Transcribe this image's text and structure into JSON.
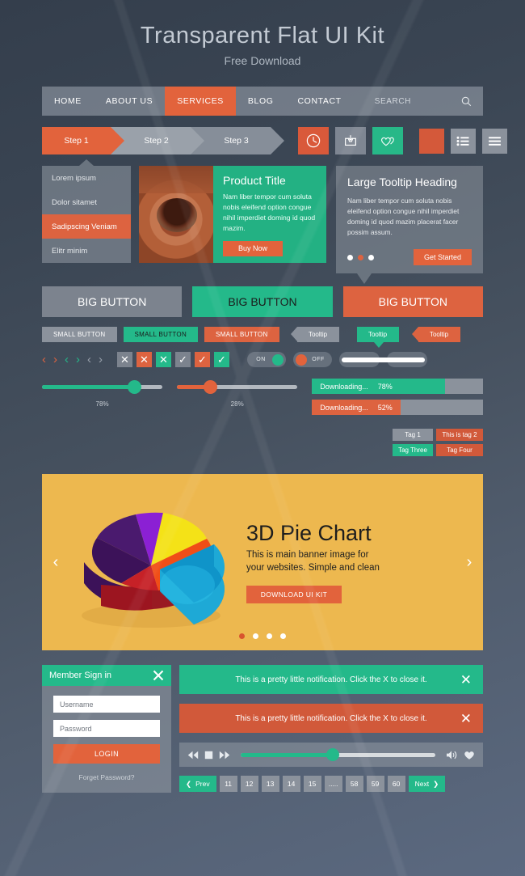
{
  "header": {
    "title": "Transparent Flat UI Kit",
    "subtitle": "Free Download"
  },
  "nav": {
    "items": [
      {
        "label": "HOME",
        "active": false
      },
      {
        "label": "ABOUT US",
        "active": false
      },
      {
        "label": "SERVICES",
        "active": true
      },
      {
        "label": "BLOG",
        "active": false
      },
      {
        "label": "CONTACT",
        "active": false
      }
    ],
    "search_placeholder": "SEARCH",
    "search_icon": "search-icon"
  },
  "steps": [
    {
      "label": "Step 1"
    },
    {
      "label": "Step 2"
    },
    {
      "label": "Step 3"
    }
  ],
  "icon_buttons": [
    {
      "icon": "clock-icon",
      "color": "#d9593a"
    },
    {
      "icon": "inbox-download-icon",
      "color": "#7e8692"
    },
    {
      "icon": "hearts-icon",
      "color": "#27b888"
    }
  ],
  "square_buttons": [
    {
      "icon": "blank-orange",
      "color": "#d4593a"
    },
    {
      "icon": "list-view-icon",
      "color": "#8b929c"
    },
    {
      "icon": "menu-lines-icon",
      "color": "#8b929c"
    }
  ],
  "side_menu": {
    "items": [
      {
        "label": "Lorem ipsum",
        "selected": false
      },
      {
        "label": "Dolor sitamet",
        "selected": false
      },
      {
        "label": "Sadipscing Veniam",
        "selected": true
      },
      {
        "label": "Elitr minim",
        "selected": false
      }
    ]
  },
  "product_card": {
    "title": "Product Title",
    "body": "Nam liber tempor cum soluta nobis eleifend option congue nihil imperdiet doming id quod mazim.",
    "button": "Buy Now",
    "image_alt": "clay-pottery-photo"
  },
  "tooltip_card": {
    "heading": "Large Tooltip Heading",
    "body": "Nam liber tempor cum soluta nobis eleifend option congue nihil imperdiet doming id quod mazim placerat facer possim assum.",
    "button": "Get Started",
    "dots": [
      {
        "active": false
      },
      {
        "active": true
      },
      {
        "active": false
      }
    ]
  },
  "big_buttons": [
    {
      "label": "BIG BUTTON",
      "color": "#7c838e"
    },
    {
      "label": "BIG BUTTON",
      "color": "#24b98a"
    },
    {
      "label": "BIG BUTTON",
      "color": "#dd6340"
    }
  ],
  "small_buttons": [
    {
      "label": "SMALL BUTTON",
      "color": "#8b929c"
    },
    {
      "label": "SMALL BUTTON",
      "color": "#24b98a"
    },
    {
      "label": "SMALL BUTTON",
      "color": "#dd6340"
    }
  ],
  "tooltips": [
    {
      "label": "Tooltip",
      "color": "#8b929c",
      "arrow": "left"
    },
    {
      "label": "Tooltip",
      "color": "#24b98a",
      "arrow": "bottom"
    },
    {
      "label": "Tooltip",
      "color": "#dd6340",
      "arrow": "left"
    }
  ],
  "arrows": [
    {
      "icon": "chevron-left-icon",
      "color": "#dd6340"
    },
    {
      "icon": "chevron-right-icon",
      "color": "#dd6340"
    },
    {
      "icon": "chevron-left-icon",
      "color": "#24b98a"
    },
    {
      "icon": "chevron-right-icon",
      "color": "#24b98a"
    },
    {
      "icon": "chevron-left-icon",
      "color": "#98a0ab"
    },
    {
      "icon": "chevron-right-icon",
      "color": "#98a0ab"
    }
  ],
  "boxes": [
    {
      "icon": "close-icon",
      "glyph": "✕",
      "color": "#7c838e"
    },
    {
      "icon": "close-icon",
      "glyph": "✕",
      "color": "#dd6340"
    },
    {
      "icon": "close-icon",
      "glyph": "✕",
      "color": "#24b98a"
    },
    {
      "icon": "check-icon",
      "glyph": "✓",
      "color": "#7c838e"
    },
    {
      "icon": "check-icon",
      "glyph": "✓",
      "color": "#dd6340"
    },
    {
      "icon": "check-icon",
      "glyph": "✓",
      "color": "#24b98a"
    }
  ],
  "toggles": [
    {
      "label": "ON",
      "knob": "right",
      "knob_color": "#24b98a"
    },
    {
      "label": "OFF",
      "knob": "left",
      "knob_color": "#e2633c"
    },
    {
      "label": "",
      "knob": "right",
      "knob_color": "#24b98a"
    },
    {
      "label": "",
      "knob": "left",
      "knob_color": "#e2633c"
    }
  ],
  "sliders": [
    {
      "value": 78,
      "value_label": "78%",
      "color": "#24b98a"
    },
    {
      "value": 28,
      "value_label": "28%",
      "color": "#e2633c"
    }
  ],
  "progress_bars": [
    {
      "label": "Downloading...",
      "value_label": "78%",
      "value": 78,
      "color": "#24b98a"
    },
    {
      "label": "Downloading...",
      "value_label": "52%",
      "value": 52,
      "color": "#dd6340"
    }
  ],
  "tags": [
    {
      "label": "Tag 1",
      "color": "#8b929c"
    },
    {
      "label": "This is tag 2",
      "color": "#d1593a"
    },
    {
      "label": "Tag Three",
      "color": "#24b98a"
    },
    {
      "label": "Tag Four",
      "color": "#d1593a"
    }
  ],
  "banner": {
    "title": "3D Pie Chart",
    "body": "This is main banner image for your websites. Simple and clean",
    "button": "DOWNLOAD UI KIT",
    "prev_icon": "chevron-left-icon",
    "next_icon": "chevron-right-icon",
    "background": "#edb84f",
    "dots": [
      {
        "active": true
      },
      {
        "active": false
      },
      {
        "active": false
      },
      {
        "active": false
      }
    ]
  },
  "chart_data": {
    "type": "pie",
    "title": "3D Pie Chart",
    "labels": [
      "Yellow",
      "Cyan",
      "Red",
      "Purple",
      "Violet",
      "Orange"
    ],
    "values": [
      17,
      22,
      18,
      15,
      16,
      12
    ],
    "colors": [
      "#f4e217",
      "#1ebdee",
      "#c62127",
      "#4a1a6e",
      "#8b20d4",
      "#f04e17"
    ],
    "legend": "none",
    "grid": false
  },
  "sign_in": {
    "heading": "Member Sign in",
    "close_icon": "close-icon",
    "username_placeholder": "Username",
    "password_placeholder": "Password",
    "login_label": "LOGIN",
    "forget_label": "Forget Password?"
  },
  "notifications": [
    {
      "text": "This is a pretty little notification. Click the X to close it.",
      "color": "#24b98a",
      "close_icon": "close-icon"
    },
    {
      "text": "This is a pretty little notification. Click the X to close it.",
      "color": "#d1593a",
      "close_icon": "close-icon"
    }
  ],
  "player": {
    "rewind_icon": "rewind-icon",
    "stop_icon": "stop-icon",
    "forward_icon": "fast-forward-icon",
    "volume_icon": "volume-icon",
    "favorite_icon": "heart-icon",
    "progress": 48
  },
  "pagination": {
    "prev_label": "Prev",
    "next_label": "Next",
    "prev_icon": "chevron-left-icon",
    "next_icon": "chevron-right-icon",
    "pages": [
      "11",
      "12",
      "13",
      "14",
      "15",
      ".....",
      "58",
      "59",
      "60"
    ]
  }
}
